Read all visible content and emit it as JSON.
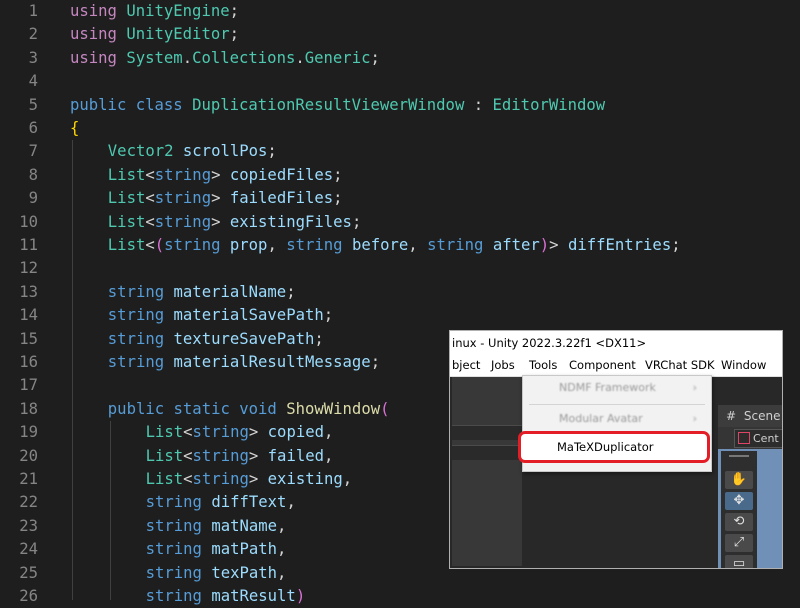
{
  "editor": {
    "lines": [
      {
        "n": "1",
        "indent": 0,
        "tokens": [
          [
            "kw2",
            "using"
          ],
          [
            "pl",
            " "
          ],
          [
            "typ",
            "UnityEngine"
          ],
          [
            "pl",
            ";"
          ]
        ]
      },
      {
        "n": "2",
        "indent": 0,
        "tokens": [
          [
            "kw2",
            "using"
          ],
          [
            "pl",
            " "
          ],
          [
            "typ",
            "UnityEditor"
          ],
          [
            "pl",
            ";"
          ]
        ]
      },
      {
        "n": "3",
        "indent": 0,
        "tokens": [
          [
            "kw2",
            "using"
          ],
          [
            "pl",
            " "
          ],
          [
            "typ",
            "System"
          ],
          [
            "pl",
            "."
          ],
          [
            "typ",
            "Collections"
          ],
          [
            "pl",
            "."
          ],
          [
            "typ",
            "Generic"
          ],
          [
            "pl",
            ";"
          ]
        ]
      },
      {
        "n": "4",
        "indent": 0,
        "tokens": []
      },
      {
        "n": "5",
        "indent": 0,
        "tokens": [
          [
            "kw",
            "public"
          ],
          [
            "pl",
            " "
          ],
          [
            "kw",
            "class"
          ],
          [
            "pl",
            " "
          ],
          [
            "typ",
            "DuplicationResultViewerWindow"
          ],
          [
            "pl",
            " : "
          ],
          [
            "typ",
            "EditorWindow"
          ]
        ]
      },
      {
        "n": "6",
        "indent": 0,
        "tokens": [
          [
            "br1",
            "{"
          ]
        ]
      },
      {
        "n": "7",
        "indent": 1,
        "tokens": [
          [
            "typ",
            "Vector2"
          ],
          [
            "pl",
            " "
          ],
          [
            "var",
            "scrollPos"
          ],
          [
            "pl",
            ";"
          ]
        ]
      },
      {
        "n": "8",
        "indent": 1,
        "tokens": [
          [
            "typ",
            "List"
          ],
          [
            "pl",
            "<"
          ],
          [
            "kw",
            "string"
          ],
          [
            "pl",
            "> "
          ],
          [
            "var",
            "copiedFiles"
          ],
          [
            "pl",
            ";"
          ]
        ]
      },
      {
        "n": "9",
        "indent": 1,
        "tokens": [
          [
            "typ",
            "List"
          ],
          [
            "pl",
            "<"
          ],
          [
            "kw",
            "string"
          ],
          [
            "pl",
            "> "
          ],
          [
            "var",
            "failedFiles"
          ],
          [
            "pl",
            ";"
          ]
        ]
      },
      {
        "n": "10",
        "indent": 1,
        "tokens": [
          [
            "typ",
            "List"
          ],
          [
            "pl",
            "<"
          ],
          [
            "kw",
            "string"
          ],
          [
            "pl",
            "> "
          ],
          [
            "var",
            "existingFiles"
          ],
          [
            "pl",
            ";"
          ]
        ]
      },
      {
        "n": "11",
        "indent": 1,
        "tokens": [
          [
            "typ",
            "List"
          ],
          [
            "pl",
            "<"
          ],
          [
            "br2",
            "("
          ],
          [
            "kw",
            "string"
          ],
          [
            "pl",
            " "
          ],
          [
            "var",
            "prop"
          ],
          [
            "pl",
            ", "
          ],
          [
            "kw",
            "string"
          ],
          [
            "pl",
            " "
          ],
          [
            "var",
            "before"
          ],
          [
            "pl",
            ", "
          ],
          [
            "kw",
            "string"
          ],
          [
            "pl",
            " "
          ],
          [
            "var",
            "after"
          ],
          [
            "br2",
            ")"
          ],
          [
            "pl",
            "> "
          ],
          [
            "var",
            "diffEntries"
          ],
          [
            "pl",
            ";"
          ]
        ]
      },
      {
        "n": "12",
        "indent": 0,
        "tokens": []
      },
      {
        "n": "13",
        "indent": 1,
        "tokens": [
          [
            "kw",
            "string"
          ],
          [
            "pl",
            " "
          ],
          [
            "var",
            "materialName"
          ],
          [
            "pl",
            ";"
          ]
        ]
      },
      {
        "n": "14",
        "indent": 1,
        "tokens": [
          [
            "kw",
            "string"
          ],
          [
            "pl",
            " "
          ],
          [
            "var",
            "materialSavePath"
          ],
          [
            "pl",
            ";"
          ]
        ]
      },
      {
        "n": "15",
        "indent": 1,
        "tokens": [
          [
            "kw",
            "string"
          ],
          [
            "pl",
            " "
          ],
          [
            "var",
            "textureSavePath"
          ],
          [
            "pl",
            ";"
          ]
        ]
      },
      {
        "n": "16",
        "indent": 1,
        "tokens": [
          [
            "kw",
            "string"
          ],
          [
            "pl",
            " "
          ],
          [
            "var",
            "materialResultMessage"
          ],
          [
            "pl",
            ";"
          ]
        ]
      },
      {
        "n": "17",
        "indent": 0,
        "tokens": []
      },
      {
        "n": "18",
        "indent": 1,
        "tokens": [
          [
            "kw",
            "public"
          ],
          [
            "pl",
            " "
          ],
          [
            "kw",
            "static"
          ],
          [
            "pl",
            " "
          ],
          [
            "kw",
            "void"
          ],
          [
            "pl",
            " "
          ],
          [
            "fn",
            "ShowWindow"
          ],
          [
            "br2",
            "("
          ]
        ]
      },
      {
        "n": "19",
        "indent": 2,
        "tokens": [
          [
            "typ",
            "List"
          ],
          [
            "pl",
            "<"
          ],
          [
            "kw",
            "string"
          ],
          [
            "pl",
            "> "
          ],
          [
            "var",
            "copied"
          ],
          [
            "pl",
            ","
          ]
        ]
      },
      {
        "n": "20",
        "indent": 2,
        "tokens": [
          [
            "typ",
            "List"
          ],
          [
            "pl",
            "<"
          ],
          [
            "kw",
            "string"
          ],
          [
            "pl",
            "> "
          ],
          [
            "var",
            "failed"
          ],
          [
            "pl",
            ","
          ]
        ]
      },
      {
        "n": "21",
        "indent": 2,
        "tokens": [
          [
            "typ",
            "List"
          ],
          [
            "pl",
            "<"
          ],
          [
            "kw",
            "string"
          ],
          [
            "pl",
            "> "
          ],
          [
            "var",
            "existing"
          ],
          [
            "pl",
            ","
          ]
        ]
      },
      {
        "n": "22",
        "indent": 2,
        "tokens": [
          [
            "kw",
            "string"
          ],
          [
            "pl",
            " "
          ],
          [
            "var",
            "diffText"
          ],
          [
            "pl",
            ","
          ]
        ]
      },
      {
        "n": "23",
        "indent": 2,
        "tokens": [
          [
            "kw",
            "string"
          ],
          [
            "pl",
            " "
          ],
          [
            "var",
            "matName"
          ],
          [
            "pl",
            ","
          ]
        ]
      },
      {
        "n": "24",
        "indent": 2,
        "tokens": [
          [
            "kw",
            "string"
          ],
          [
            "pl",
            " "
          ],
          [
            "var",
            "matPath"
          ],
          [
            "pl",
            ","
          ]
        ]
      },
      {
        "n": "25",
        "indent": 2,
        "tokens": [
          [
            "kw",
            "string"
          ],
          [
            "pl",
            " "
          ],
          [
            "var",
            "texPath"
          ],
          [
            "pl",
            ","
          ]
        ]
      },
      {
        "n": "26",
        "indent": 2,
        "tokens": [
          [
            "kw",
            "string"
          ],
          [
            "pl",
            " "
          ],
          [
            "var",
            "matResult"
          ],
          [
            "br2",
            ")"
          ]
        ]
      }
    ]
  },
  "unity": {
    "title": "inux - Unity 2022.3.22f1 <DX11>",
    "menu": [
      "bject",
      "Jobs",
      "Tools",
      "Component",
      "VRChat SDK",
      "Window"
    ],
    "dropdown": {
      "items": [
        {
          "label": "NDMF Framework",
          "arrow": "›"
        },
        {
          "label": "Modular Avatar",
          "arrow": "›"
        }
      ],
      "highlighted_item": "MaTeXDuplicator"
    },
    "scene_tab": {
      "icon": "#",
      "label": "Scene"
    },
    "center_button": "Cent",
    "tools": [
      "✋",
      "✥",
      "⟲",
      "⤢",
      "▭"
    ]
  }
}
